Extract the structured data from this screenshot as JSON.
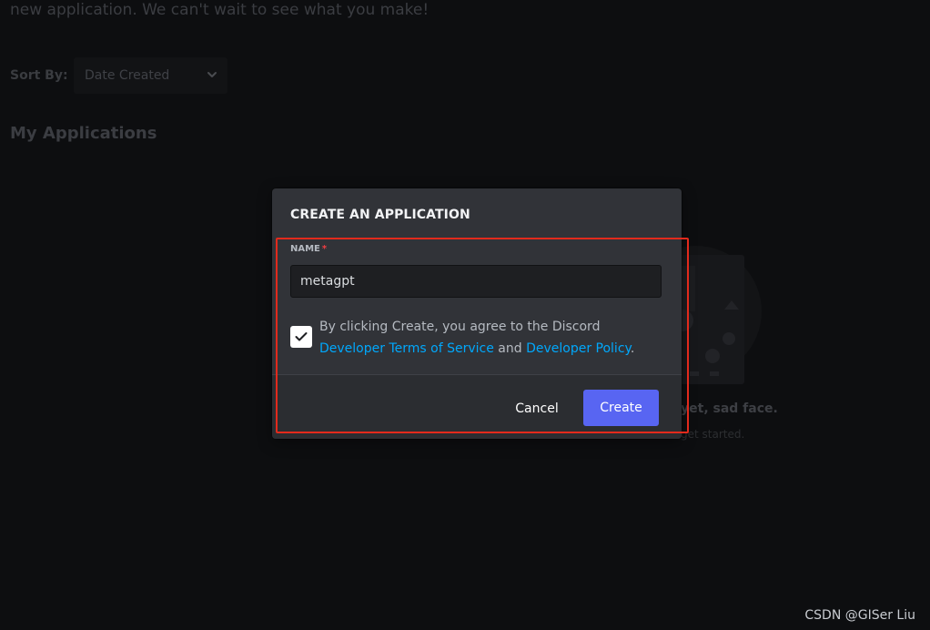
{
  "page": {
    "intro_text": "new application. We can't wait to see what you make!",
    "sort_by_label": "Sort By:",
    "sort_by_value": "Date Created",
    "section_title": "My Applications",
    "empty_title": "yet, sad face.",
    "empty_subtitle": "get started."
  },
  "modal": {
    "title": "CREATE AN APPLICATION",
    "name_label": "NAME",
    "required_marker": "*",
    "name_value": "metagpt",
    "tos_checked": true,
    "tos_prefix": "By clicking Create, you agree to the Discord ",
    "tos_link_1": "Developer Terms of Service",
    "tos_middle": " and ",
    "tos_link_2": "Developer Policy",
    "tos_suffix": ".",
    "cancel_label": "Cancel",
    "create_label": "Create"
  },
  "watermark": "CSDN @GISer Liu",
  "colors": {
    "page_background": "#0d0e10",
    "modal_background": "#313338",
    "footer_background": "#2b2d31",
    "input_background": "#1e1f22",
    "link": "#00a8fc",
    "create_button": "#5865f2",
    "required": "#f23f43",
    "highlight_box": "#e22a1c"
  },
  "icons": {
    "sort_dropdown": "chevron-down-icon",
    "checkbox_state": "checkmark-icon"
  }
}
